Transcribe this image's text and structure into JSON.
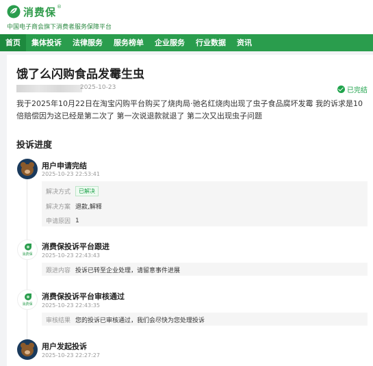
{
  "brand": {
    "name": "消费保",
    "reg": "®",
    "tagline": "中国电子商会旗下消费者服务保障平台"
  },
  "nav": [
    "首页",
    "集体投诉",
    "法律服务",
    "服务榜单",
    "企业服务",
    "行业数据",
    "资讯"
  ],
  "complaint": {
    "title": "饿了么闪购食品发霉生虫",
    "date": "2025-10-23",
    "status": "已完结",
    "description": "我于2025年10月22日在淘宝闪购平台购买了烧肉局·驰名红烧肉出现了虫子食品腐坏发霉 我的诉求是10倍赔偿因为这已经是第二次了 第一次说退款就退了 第二次又出现虫子问题"
  },
  "progress": {
    "heading": "投诉进度",
    "events": [
      {
        "title": "用户申请完结",
        "time": "2025-10-23 22:53:41",
        "avatar": "bear-avatar",
        "rows": [
          {
            "label": "解决方式",
            "value": "已解决",
            "tag": true
          },
          {
            "label": "解决方案",
            "value": "退款,解释"
          },
          {
            "label": "申请原因",
            "value": "1"
          }
        ]
      },
      {
        "title": "消费保投诉平台跟进",
        "time": "2025-10-23 22:43:43",
        "avatar": "xiaofeibao-logo",
        "avatar_label": "消费保",
        "rows": [
          {
            "label": "跟进内容",
            "value": "投诉已转至企业处理，请留意事件进展"
          }
        ]
      },
      {
        "title": "消费保投诉平台审核通过",
        "time": "2025-10-23 22:43:35",
        "avatar": "xiaofeibao-logo",
        "avatar_label": "消费保",
        "rows": [
          {
            "label": "审核结果",
            "value": "您的投诉已审核通过，我们会尽快为您处理投诉"
          }
        ]
      },
      {
        "title": "用户发起投诉",
        "time": "2025-10-23 22:27:27",
        "avatar": "bear-avatar"
      }
    ]
  },
  "colors": {
    "brand_green": "#2a9d4d",
    "status_green": "#1fa34b"
  }
}
